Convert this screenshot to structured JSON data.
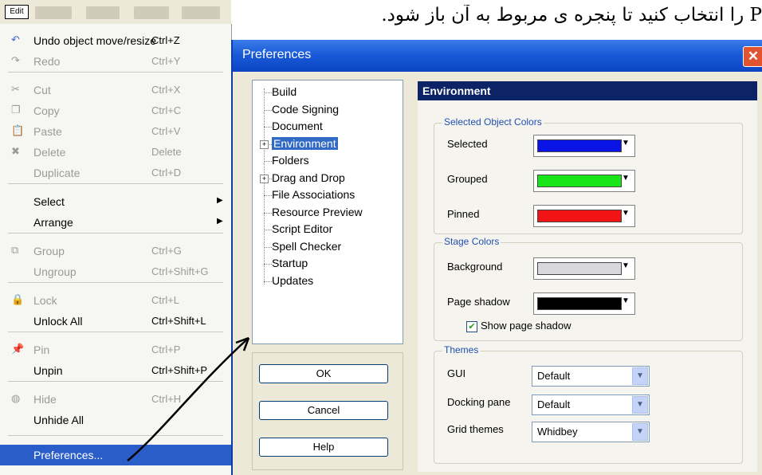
{
  "caption": "P را انتخاب کنید تا پنجره ی مربوط به آن باز شود.",
  "menubar": {
    "edit_label": "Edit"
  },
  "menu": {
    "items": [
      {
        "label": "Undo object move/resize",
        "shortcut": "Ctrl+Z",
        "icon": "undo-icon",
        "disabled": false
      },
      {
        "label": "Redo",
        "shortcut": "Ctrl+Y",
        "icon": "redo-icon",
        "disabled": true
      },
      {
        "label": "Cut",
        "shortcut": "Ctrl+X",
        "icon": "cut-icon",
        "disabled": true
      },
      {
        "label": "Copy",
        "shortcut": "Ctrl+C",
        "icon": "copy-icon",
        "disabled": true
      },
      {
        "label": "Paste",
        "shortcut": "Ctrl+V",
        "icon": "paste-icon",
        "disabled": true
      },
      {
        "label": "Delete",
        "shortcut": "Delete",
        "icon": "delete-icon",
        "disabled": true
      },
      {
        "label": "Duplicate",
        "shortcut": "Ctrl+D",
        "icon": "",
        "disabled": true
      },
      {
        "label": "Select",
        "shortcut": "",
        "icon": "",
        "disabled": false,
        "submenu": true
      },
      {
        "label": "Arrange",
        "shortcut": "",
        "icon": "",
        "disabled": false,
        "submenu": true
      },
      {
        "label": "Group",
        "shortcut": "Ctrl+G",
        "icon": "group-icon",
        "disabled": true
      },
      {
        "label": "Ungroup",
        "shortcut": "Ctrl+Shift+G",
        "icon": "",
        "disabled": true
      },
      {
        "label": "Lock",
        "shortcut": "Ctrl+L",
        "icon": "lock-icon",
        "disabled": true
      },
      {
        "label": "Unlock All",
        "shortcut": "Ctrl+Shift+L",
        "icon": "",
        "disabled": false
      },
      {
        "label": "Pin",
        "shortcut": "Ctrl+P",
        "icon": "pin-icon",
        "disabled": true
      },
      {
        "label": "Unpin",
        "shortcut": "Ctrl+Shift+P",
        "icon": "",
        "disabled": false
      },
      {
        "label": "Hide",
        "shortcut": "Ctrl+H",
        "icon": "hide-icon",
        "disabled": true
      },
      {
        "label": "Unhide All",
        "shortcut": "",
        "icon": "",
        "disabled": false
      },
      {
        "label": "Preferences...",
        "shortcut": "",
        "icon": "",
        "disabled": false,
        "selected": true
      }
    ]
  },
  "dialog": {
    "title": "Preferences",
    "close": "✕",
    "tree": [
      "Build",
      "Code Signing",
      "Document",
      "Environment",
      "Folders",
      "Drag and Drop",
      "File Associations",
      "Resource Preview",
      "Script Editor",
      "Spell Checker",
      "Startup",
      "Updates"
    ],
    "selected_node": "Environment",
    "buttons": {
      "ok": "OK",
      "cancel": "Cancel",
      "help": "Help"
    },
    "panel": {
      "heading": "Environment",
      "selected_colors": {
        "title": "Selected Object Colors",
        "rows": [
          {
            "label": "Selected",
            "color": "#0a14e6"
          },
          {
            "label": "Grouped",
            "color": "#19e619"
          },
          {
            "label": "Pinned",
            "color": "#f01414"
          }
        ]
      },
      "stage_colors": {
        "title": "Stage Colors",
        "rows": [
          {
            "label": "Background",
            "color": "#d8d8dc"
          },
          {
            "label": "Page shadow",
            "color": "#000000"
          }
        ],
        "checkbox_label": "Show page shadow",
        "checkbox_checked": true
      },
      "themes": {
        "title": "Themes",
        "rows": [
          {
            "label": "GUI",
            "value": "Default"
          },
          {
            "label": "Docking pane",
            "value": "Default"
          },
          {
            "label": "Grid themes",
            "value": "Whidbey"
          }
        ]
      }
    }
  }
}
